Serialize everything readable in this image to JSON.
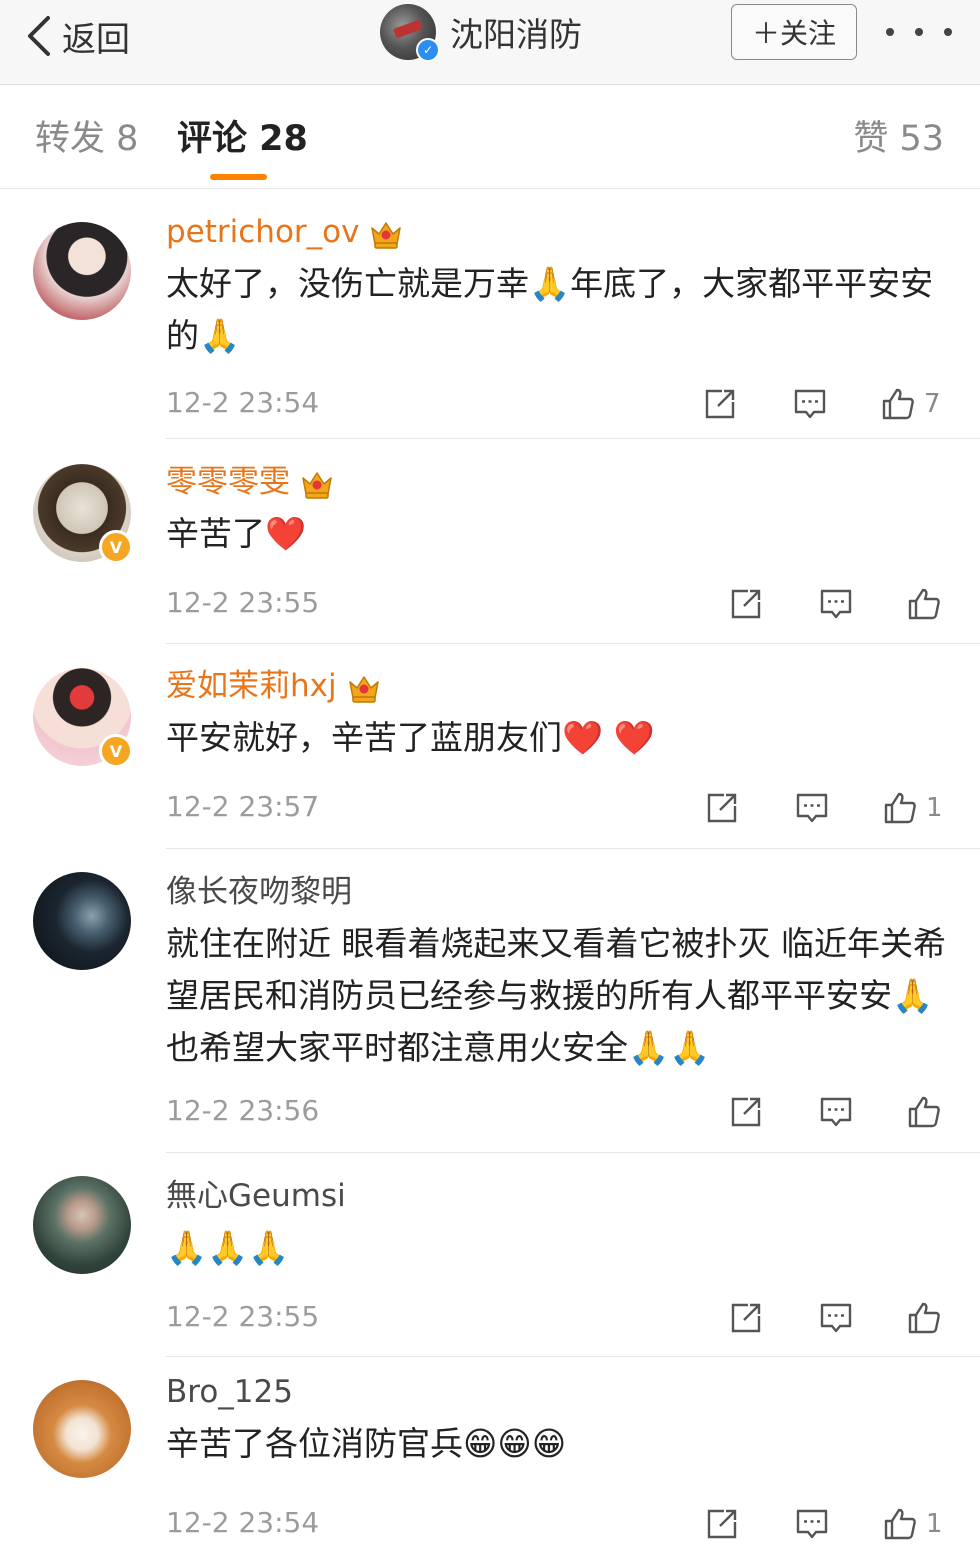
{
  "topbar": {
    "back_label": "返回",
    "account_name": "沈阳消防",
    "follow_label": "＋关注",
    "more_icon": "more-dots-icon"
  },
  "tabs": {
    "forward": "转发 8",
    "comments": "评论 28",
    "likes": "赞 53",
    "active_color": "#ff8200"
  },
  "comments": [
    {
      "user": "petrichor_ov",
      "vip": true,
      "verified": false,
      "text": "太好了，没伤亡就是万幸🙏年底了，大家都平平安安的🙏",
      "time": "12-2 23:54",
      "likes": "7"
    },
    {
      "user": "零零零雯",
      "vip": true,
      "verified": true,
      "text": "辛苦了❤️",
      "time": "12-2 23:55",
      "likes": ""
    },
    {
      "user": "爱如茉莉hxj",
      "vip": true,
      "verified": true,
      "text": "平安就好，辛苦了蓝朋友们❤️ ❤️",
      "time": "12-2 23:57",
      "likes": "1"
    },
    {
      "user": "像长夜吻黎明",
      "vip": false,
      "verified": false,
      "text": "就住在附近 眼看着烧起来又看着它被扑灭 临近年关希望居民和消防员已经参与救援的所有人都平平安安🙏 也希望大家平时都注意用火安全🙏🙏",
      "time": "12-2 23:56",
      "likes": ""
    },
    {
      "user": "無心Geumsi",
      "vip": false,
      "verified": false,
      "text": "🙏🙏🙏",
      "time": "12-2 23:55",
      "likes": ""
    },
    {
      "user": "Bro_125",
      "vip": false,
      "verified": false,
      "text": "辛苦了各位消防官兵😁😁😁",
      "time": "12-2 23:54",
      "likes": "1"
    }
  ]
}
